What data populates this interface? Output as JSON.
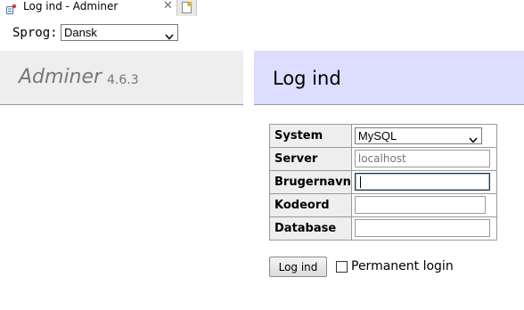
{
  "tab": {
    "title": "Log ind - Adminer",
    "favicon": "adminer-favicon-icon",
    "close_icon": "close-icon",
    "new_tab_icon": "new-tab-icon"
  },
  "language": {
    "label": "Sprog:",
    "selected": "Dansk"
  },
  "header": {
    "app_name": "Adminer",
    "version": "4.6.3",
    "page_title": "Log ind"
  },
  "form": {
    "fields": [
      {
        "label": "System",
        "type": "select",
        "value": "MySQL"
      },
      {
        "label": "Server",
        "type": "text",
        "value": "",
        "placeholder": "localhost"
      },
      {
        "label": "Brugernavn",
        "type": "text",
        "value": ""
      },
      {
        "label": "Kodeord",
        "type": "password",
        "value": ""
      },
      {
        "label": "Database",
        "type": "text",
        "value": ""
      }
    ],
    "submit_label": "Log ind",
    "permanent_label": "Permanent login",
    "permanent_checked": false
  },
  "colors": {
    "heading_bg": "#ddddff",
    "logo_bg": "#eeeeee",
    "logo_text": "#777777",
    "border": "#999999"
  }
}
